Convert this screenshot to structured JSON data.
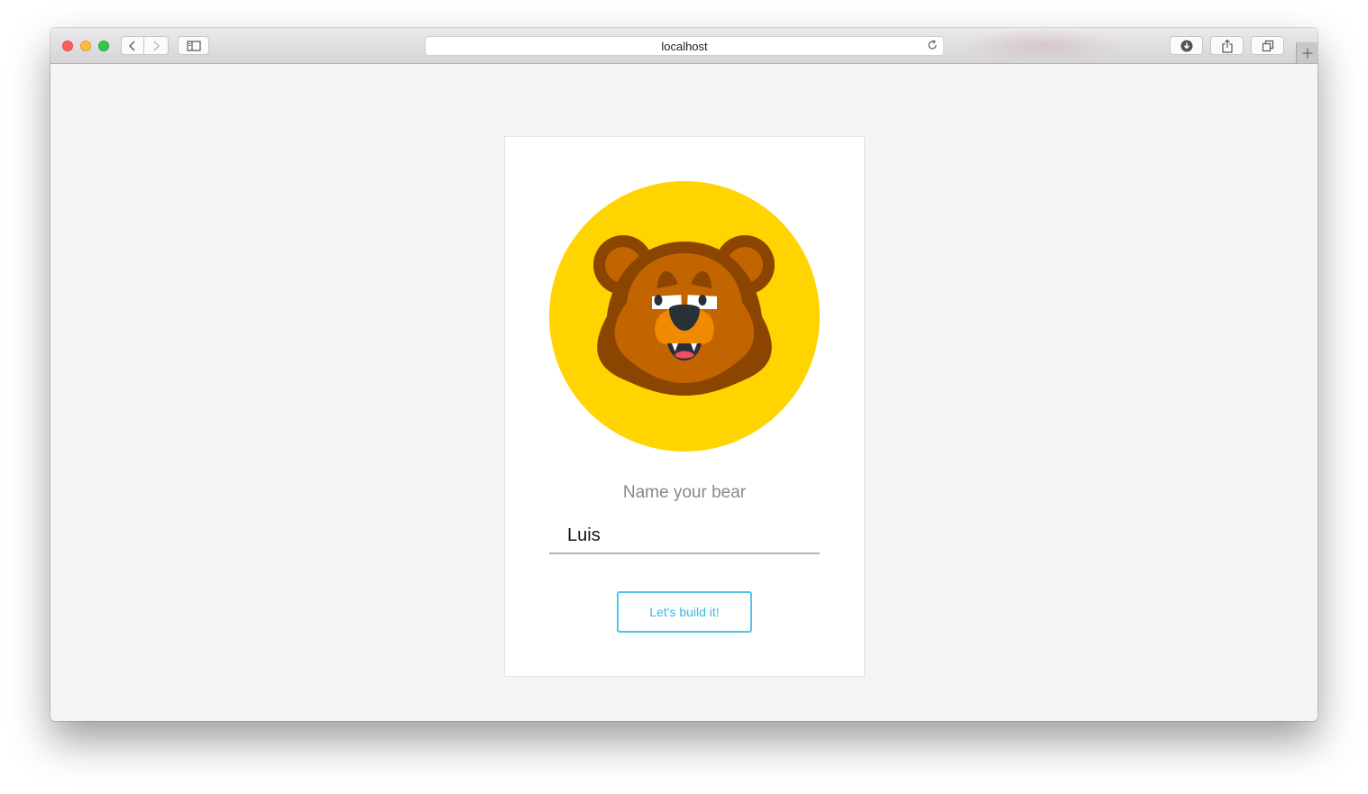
{
  "browser": {
    "address": "localhost",
    "icons": {
      "back": "chevron-left-icon",
      "forward": "chevron-right-icon",
      "sidebar": "sidebar-icon",
      "reload": "reload-icon",
      "download": "download-icon",
      "share": "share-icon",
      "tabs": "tabs-icon",
      "new_tab": "plus-icon"
    }
  },
  "card": {
    "prompt": "Name your bear",
    "name_value": "Luis",
    "button_label": "Let's build it!"
  },
  "colors": {
    "avatar_background": "#FFD400",
    "bear_dark": "#8B4500",
    "bear_main": "#C26500",
    "bear_muzzle": "#F08A00",
    "button_accent": "#4FC6E8"
  }
}
